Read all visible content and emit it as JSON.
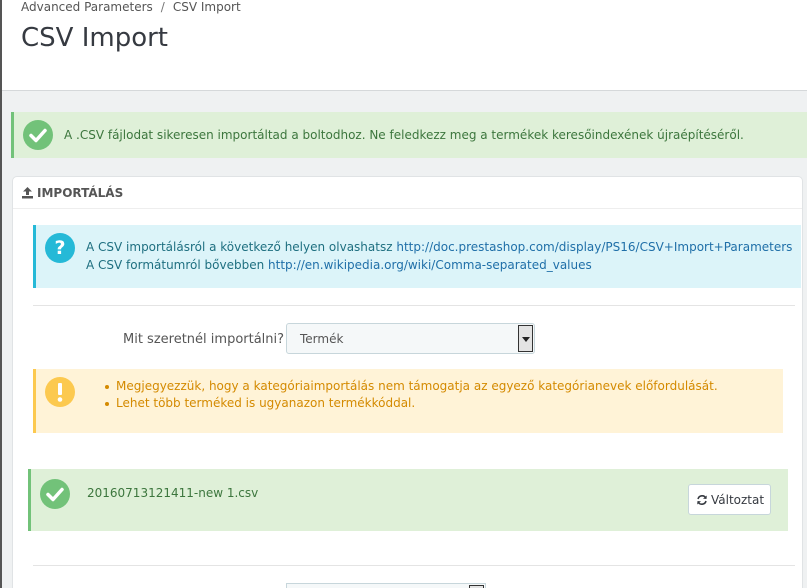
{
  "breadcrumb": {
    "parent": "Advanced Parameters",
    "separator": "/",
    "current": "CSV Import"
  },
  "page_title": "CSV Import",
  "alert_success": {
    "text": "A .CSV fájlodat sikeresen importáltad a boltodhoz. Ne feledkezz meg a termékek keresőindexének újraépítéséről."
  },
  "panel": {
    "title": "IMPORTÁLÁS"
  },
  "info": {
    "line1_prefix": "A CSV importálásról a következő helyen olvashatsz",
    "line1_link": "http://doc.prestashop.com/display/PS16/CSV+Import+Parameters",
    "line2_prefix": "A CSV formátumról bővebben",
    "line2_link": "http://en.wikipedia.org/wiki/Comma-separated_values"
  },
  "import_select": {
    "label": "Mit szeretnél importálni?",
    "value": "Termék"
  },
  "warnings": [
    "Megjegyezzük, hogy a kategóriaimportálás nem támogatja az egyező kategórianevek előfordulását.",
    "Lehet több terméked is ugyanazon termékkóddal."
  ],
  "file": {
    "name": "20160713121411-new 1.csv",
    "change_label": "Változtat"
  },
  "colors": {
    "success": "#dff0d8",
    "info": "#dcf4f9",
    "warning": "#fff3d7",
    "success_icon": "#72c279",
    "info_icon": "#25b9d7",
    "warning_icon": "#fcc94f"
  },
  "icons": {
    "success": "check-circle-icon",
    "info": "question-circle-icon",
    "warning": "exclamation-circle-icon",
    "upload": "upload-icon",
    "refresh": "refresh-icon"
  }
}
